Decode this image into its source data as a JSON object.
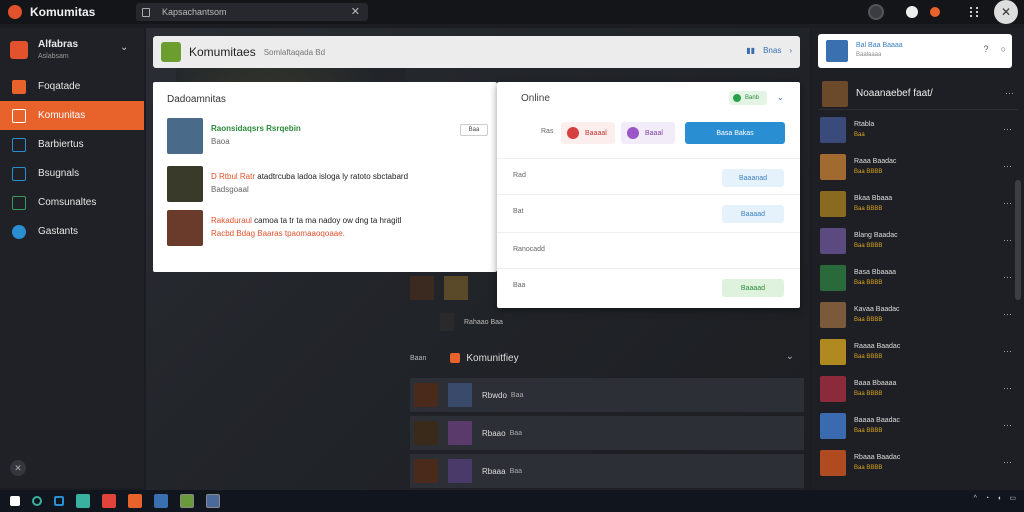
{
  "window": {
    "title": "Komumitas"
  },
  "search": {
    "value": "Kapsachantsom"
  },
  "sidebar": {
    "header": {
      "title": "Alfabras",
      "subtitle": "Aslabsam"
    },
    "items": [
      {
        "label": "Foqatade",
        "icon": "home-icon",
        "color": "#e8622c",
        "active": false
      },
      {
        "label": "Komunitas",
        "icon": "community-icon",
        "color": "#ffffff",
        "active": true
      },
      {
        "label": "Barbiertus",
        "icon": "bookmark-icon",
        "color": "#2a8fd2",
        "active": false
      },
      {
        "label": "Bsugnals",
        "icon": "list-icon",
        "color": "#2a8fd2",
        "active": false
      },
      {
        "label": "Comsunaltes",
        "icon": "window-icon",
        "color": "#3a9a5a",
        "active": false
      },
      {
        "label": "Gastants",
        "icon": "globe-icon",
        "color": "#2a8fd2",
        "active": false
      }
    ]
  },
  "topcard": {
    "title": "Komumitaes",
    "subtitle": "Somlaftaqada Bd",
    "action": "Bnas"
  },
  "feed": {
    "title": "Dadoamnitas",
    "items": [
      {
        "title": "Raonsidaqsrs Rsrqebin",
        "sub": "Baoa"
      },
      {
        "prefix": "D Rtbul Ratr",
        "text": "atadtrcuba ladoa isloga ly ratoto sbctabard",
        "sub": "Badsgoaal"
      },
      {
        "prefix": "Rakaduraul",
        "text": "camoa ta tr ta ma nadoy ow dng ta hragitl",
        "sub": "Racbd Bdag Baaras",
        "tail": "tpaomaaoqoaae."
      }
    ],
    "button": "Baa"
  },
  "online": {
    "title": "Online",
    "status": "Banb",
    "filter_label": "Ras",
    "chips": [
      "Baaaal",
      "Baaal"
    ],
    "action": "Basa Bakas",
    "rows": [
      {
        "label": "Rad",
        "button": "Baaanad",
        "style": "blue"
      },
      {
        "label": "Bat",
        "button": "Baaaad",
        "style": "blue"
      },
      {
        "label": "Ranocadd",
        "button": "",
        "style": ""
      },
      {
        "label": "Baa",
        "button": "Baaaad",
        "style": "green"
      }
    ]
  },
  "dark_list": {
    "rows_above": [
      {
        "name": "Rahaao Baa"
      }
    ],
    "section": {
      "title": "Komunitfiey",
      "prefix": "Baan"
    },
    "items": [
      {
        "name": "Rbwdo",
        "sub": "Baa"
      },
      {
        "name": "Rbaao",
        "sub": "Baa"
      },
      {
        "name": "Rbaaa",
        "sub": "Baa"
      }
    ]
  },
  "right": {
    "profile": {
      "title": "Bal Baa Baaaa",
      "sub": "Baalaaaa"
    },
    "header": "Noaanaebef faat/",
    "items": [
      {
        "name": "Rtabla",
        "tag": "Baa",
        "color": "#3a4a7a"
      },
      {
        "name": "Raaa Baadac",
        "tag": "Baa BBBB",
        "color": "#a06a30"
      },
      {
        "name": "Bkaa Bbaaa",
        "tag": "Baa BBBB",
        "color": "#8a6a20"
      },
      {
        "name": "Blang Baadac",
        "tag": "Baa BBBB",
        "color": "#5a4a80"
      },
      {
        "name": "Basa Bbaaaa",
        "tag": "Baa BBBB",
        "color": "#2a6a3a"
      },
      {
        "name": "Kavaa Baadac",
        "tag": "Baa BBBB",
        "color": "#7a5a3a"
      },
      {
        "name": "Raaaa Baadac",
        "tag": "Baa BBBB",
        "color": "#b08a20"
      },
      {
        "name": "Baaa Bbaaaa",
        "tag": "Baa BBBB",
        "color": "#8a2a3a"
      },
      {
        "name": "Baaaa Baadac",
        "tag": "Baa BBBB",
        "color": "#3a6ab0"
      },
      {
        "name": "Rbaaa Baadac",
        "tag": "Baa BBBB",
        "color": "#b04a20"
      }
    ]
  },
  "colors": {
    "accent": "#e8622c",
    "primary": "#2a8fd2",
    "success": "#2aa04a"
  }
}
